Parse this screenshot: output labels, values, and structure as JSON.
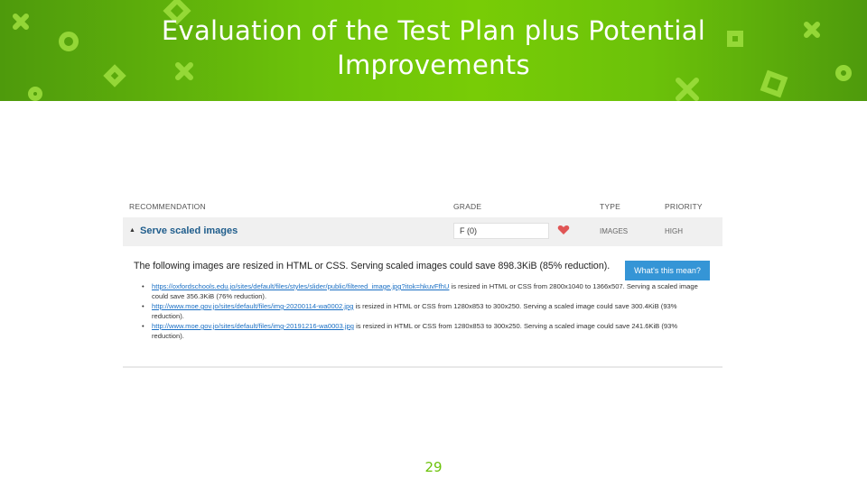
{
  "slide": {
    "title_line1": "Evaluation of the Test Plan plus Potential",
    "title_line2": "Improvements",
    "page_number": "29"
  },
  "colors": {
    "banner": "#6cc20a",
    "link": "#1a6fc4",
    "button": "#3595d6",
    "heart": "#e05555"
  },
  "table": {
    "headers": {
      "recommendation": "RECOMMENDATION",
      "grade": "GRADE",
      "type": "TYPE",
      "priority": "PRIORITY"
    },
    "row": {
      "name": "Serve scaled images",
      "grade": "F (0)",
      "type": "IMAGES",
      "priority": "HIGH",
      "expand_icon": "triangle-up-icon",
      "grade_icon": "heart-icon"
    },
    "detail": {
      "summary": "The following images are resized in HTML or CSS. Serving scaled images could save 898.3KiB (85% reduction).",
      "button_label": "What's this mean?",
      "items": [
        {
          "link": "https://oxfordschools.edu.jo/sites/default/files/styles/slider/public/filtered_image.jpg?itok=hkuvFfhU",
          "text": " is resized in HTML or CSS from 2800x1040 to 1366x507. Serving a scaled image could save 356.3KiB (76% reduction)."
        },
        {
          "link": "http://www.moe.gov.jo/sites/default/files/img-20200114-wa0002.jpg",
          "text": " is resized in HTML or CSS from 1280x853 to 300x250. Serving a scaled image could save 300.4KiB (93% reduction)."
        },
        {
          "link": "http://www.moe.gov.jo/sites/default/files/img-20191216-wa0003.jpg",
          "text": " is resized in HTML or CSS from 1280x853 to 300x250. Serving a scaled image could save 241.6KiB (93% reduction)."
        }
      ]
    }
  }
}
